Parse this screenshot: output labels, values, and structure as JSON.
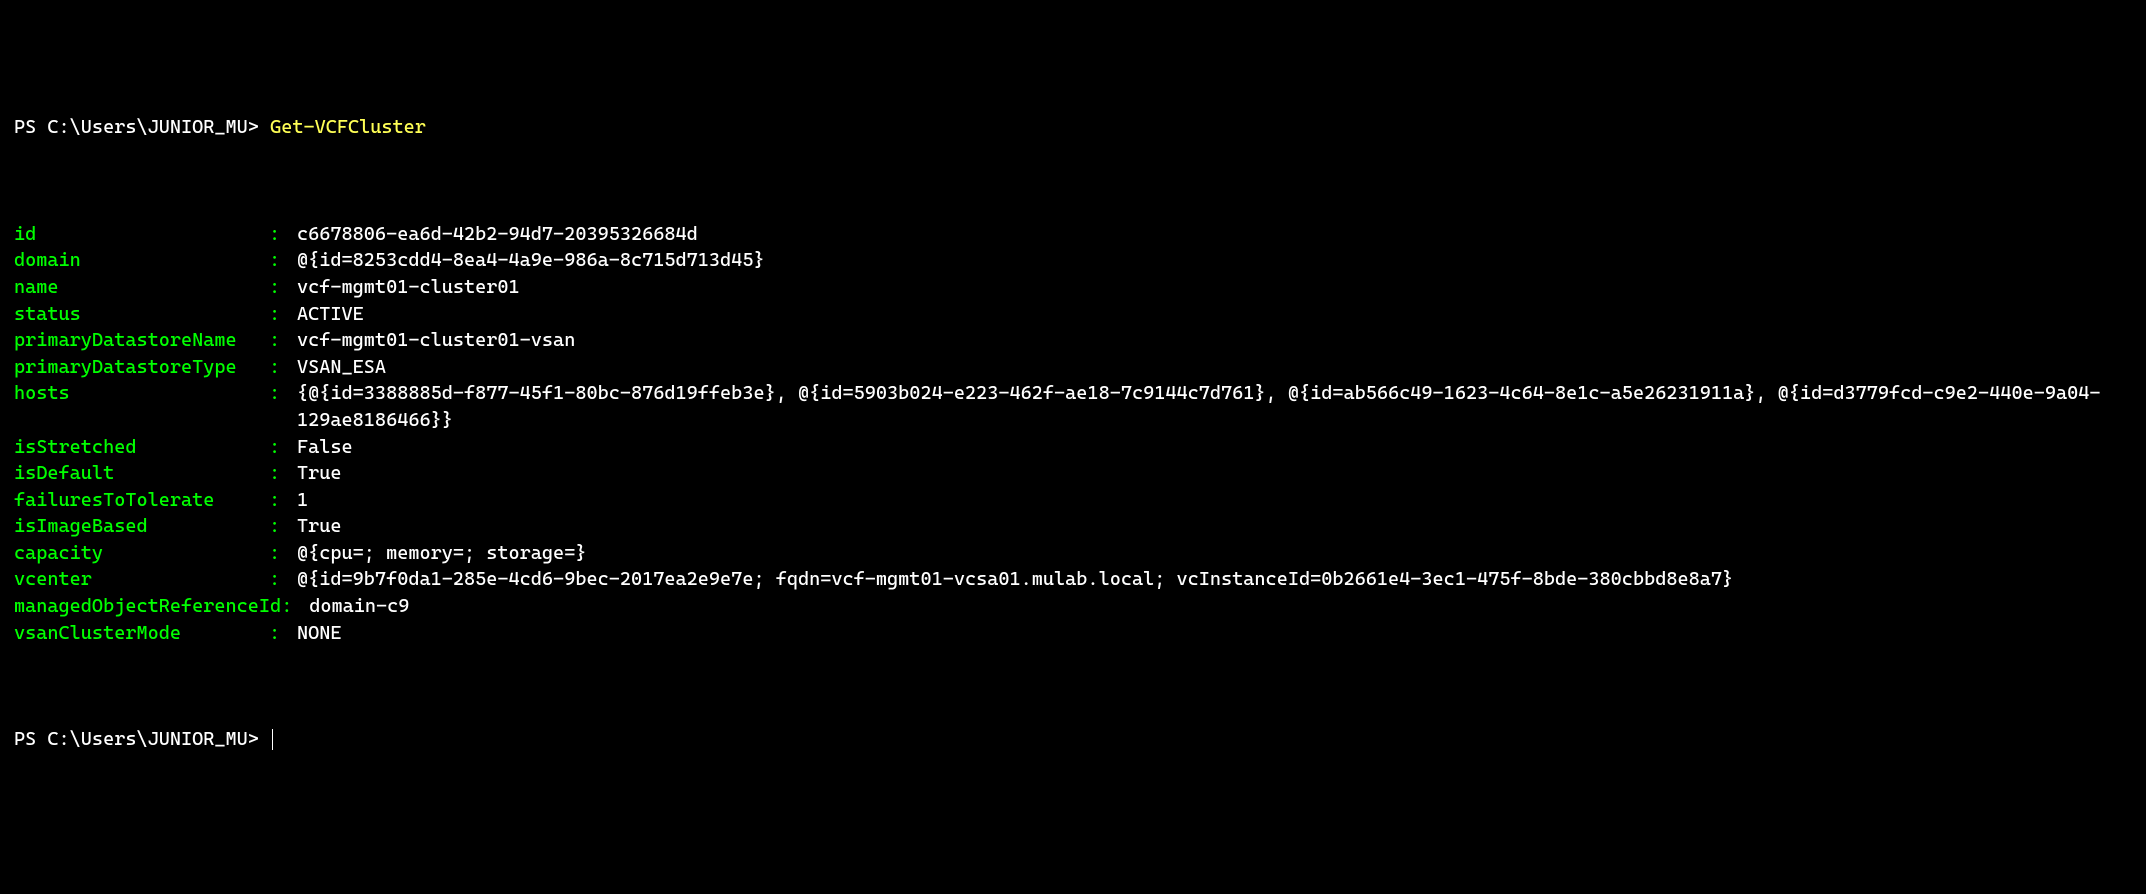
{
  "prompt1": {
    "prefix": "PS C:\\Users\\JUNIOR_MU> ",
    "command": "Get-VCFCluster"
  },
  "properties": [
    {
      "key": "id",
      "value": "c6678806-ea6d-42b2-94d7-20395326684d"
    },
    {
      "key": "domain",
      "value": "@{id=8253cdd4-8ea4-4a9e-986a-8c715d713d45}"
    },
    {
      "key": "name",
      "value": "vcf-mgmt01-cluster01"
    },
    {
      "key": "status",
      "value": "ACTIVE"
    },
    {
      "key": "primaryDatastoreName",
      "value": "vcf-mgmt01-cluster01-vsan"
    },
    {
      "key": "primaryDatastoreType",
      "value": "VSAN_ESA"
    },
    {
      "key": "hosts",
      "value": "{@{id=3388885d-f877-45f1-80bc-876d19ffeb3e}, @{id=5903b024-e223-462f-ae18-7c9144c7d761}, @{id=ab566c49-1623-4c64-8e1c-a5e26231911a}, @{id=d3779fcd-c9e2-440e-9a04-129ae8186466}}"
    },
    {
      "key": "isStretched",
      "value": "False"
    },
    {
      "key": "isDefault",
      "value": "True"
    },
    {
      "key": "failuresToTolerate",
      "value": "1"
    },
    {
      "key": "isImageBased",
      "value": "True"
    },
    {
      "key": "capacity",
      "value": "@{cpu=; memory=; storage=}"
    },
    {
      "key": "vcenter",
      "value": "@{id=9b7f0da1-285e-4cd6-9bec-2017ea2e9e7e; fqdn=vcf-mgmt01-vcsa01.mulab.local; vcInstanceId=0b2661e4-3ec1-475f-8bde-380cbbd8e8a7}"
    },
    {
      "key": "managedObjectReferenceId",
      "value": "domain-c9"
    },
    {
      "key": "vsanClusterMode",
      "value": "NONE"
    }
  ],
  "prompt2": {
    "prefix": "PS C:\\Users\\JUNIOR_MU> "
  }
}
